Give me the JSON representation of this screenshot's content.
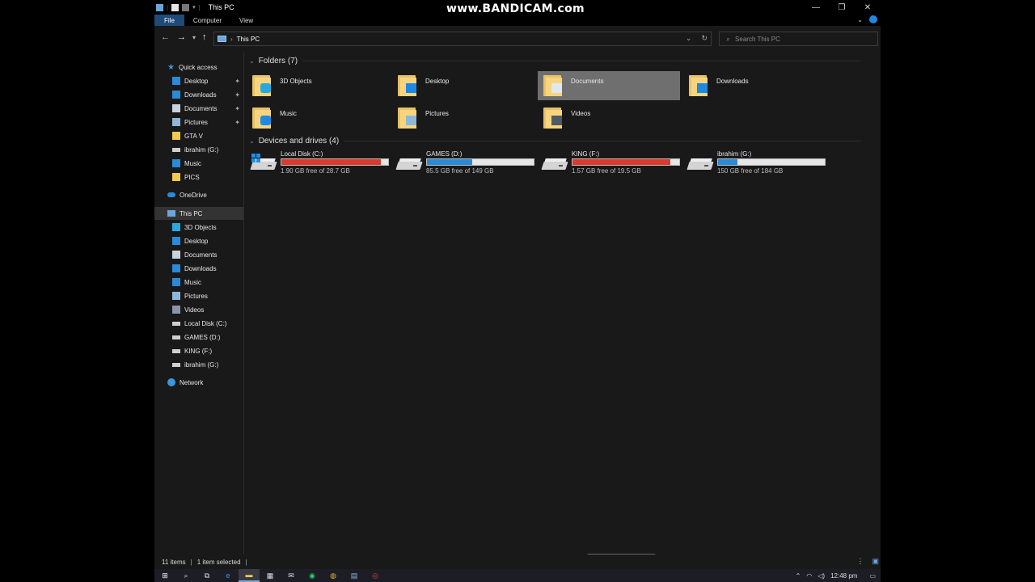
{
  "window": {
    "title": "This PC",
    "watermark": "www.BANDICAM.com",
    "controls": {
      "minimize": "—",
      "restore": "❐",
      "close": "✕"
    }
  },
  "ribbon": {
    "tabs": [
      {
        "label": "File",
        "active": true
      },
      {
        "label": "Computer",
        "active": false
      },
      {
        "label": "View",
        "active": false
      }
    ],
    "expand": "⌄"
  },
  "address": {
    "path": "This PC",
    "search_placeholder": "Search This PC"
  },
  "nav": {
    "quick_access": "Quick access",
    "qa_items": [
      {
        "label": "Desktop",
        "icon": "desktop-icon",
        "pinned": true
      },
      {
        "label": "Downloads",
        "icon": "download-arrow-icon",
        "pinned": true
      },
      {
        "label": "Documents",
        "icon": "document-icon",
        "pinned": true
      },
      {
        "label": "Pictures",
        "icon": "pictures-icon",
        "pinned": true
      },
      {
        "label": "GTA V",
        "icon": "folder-icon",
        "pinned": false
      },
      {
        "label": "ibrahim (G:)",
        "icon": "drive-icon",
        "pinned": false
      },
      {
        "label": "Music",
        "icon": "music-note-icon",
        "pinned": false
      },
      {
        "label": "PICS",
        "icon": "folder-icon",
        "pinned": false
      }
    ],
    "onedrive": "OneDrive",
    "this_pc": "This PC",
    "pc_items": [
      {
        "label": "3D Objects",
        "icon": "cube-icon"
      },
      {
        "label": "Desktop",
        "icon": "desktop-icon"
      },
      {
        "label": "Documents",
        "icon": "document-icon"
      },
      {
        "label": "Downloads",
        "icon": "download-arrow-icon"
      },
      {
        "label": "Music",
        "icon": "music-note-icon"
      },
      {
        "label": "Pictures",
        "icon": "pictures-icon"
      },
      {
        "label": "Videos",
        "icon": "film-icon"
      },
      {
        "label": "Local Disk (C:)",
        "icon": "drive-icon"
      },
      {
        "label": "GAMES (D:)",
        "icon": "drive-icon"
      },
      {
        "label": "KING (F:)",
        "icon": "drive-icon"
      },
      {
        "label": "ibrahim (G:)",
        "icon": "drive-icon"
      }
    ],
    "network": "Network"
  },
  "folders": {
    "heading": "Folders (7)",
    "items": [
      {
        "label": "3D Objects",
        "selected": false,
        "badge": "cube",
        "badge_color": "#29a8e0"
      },
      {
        "label": "Desktop",
        "selected": false,
        "badge": "monitor",
        "badge_color": "#1e88e5"
      },
      {
        "label": "Documents",
        "selected": true,
        "badge": "page",
        "badge_color": "#dfe7ef"
      },
      {
        "label": "Downloads",
        "selected": false,
        "badge": "arrow",
        "badge_color": "#1e88e5"
      },
      {
        "label": "Music",
        "selected": false,
        "badge": "note",
        "badge_color": "#1e88e5"
      },
      {
        "label": "Pictures",
        "selected": false,
        "badge": "landscape",
        "badge_color": "#8fb8d8"
      },
      {
        "label": "Videos",
        "selected": false,
        "badge": "film",
        "badge_color": "#505a66"
      }
    ]
  },
  "drives": {
    "heading": "Devices and drives (4)",
    "items": [
      {
        "name": "Local Disk (C:)",
        "free_text": "1.90 GB free of 28.7 GB",
        "used_fraction": 0.934,
        "bar_color": "#da3b2c",
        "system": true
      },
      {
        "name": "GAMES (D:)",
        "free_text": "85.5 GB free of 149 GB",
        "used_fraction": 0.426,
        "bar_color": "#2a8ad8",
        "system": false
      },
      {
        "name": "KING (F:)",
        "free_text": "1.57 GB free of 19.5 GB",
        "used_fraction": 0.919,
        "bar_color": "#da3b2c",
        "system": false
      },
      {
        "name": "ibrahim (G:)",
        "free_text": "150 GB free of 184 GB",
        "used_fraction": 0.185,
        "bar_color": "#2a8ad8",
        "system": false
      }
    ]
  },
  "status": {
    "items_count": "11 items",
    "selected": "1 item selected"
  },
  "taskbar": {
    "clock": "12:48 pm"
  },
  "accent": "#1e88e5"
}
